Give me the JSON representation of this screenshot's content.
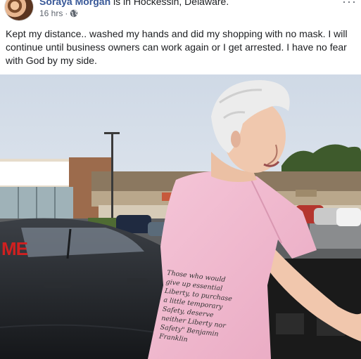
{
  "post": {
    "author": "Soraya Morgan",
    "location_text": "is in Hockessin, Delaware.",
    "timestamp": "16 hrs",
    "privacy_icon": "globe-icon",
    "more_icon": "more-options-icon",
    "text": "Kept my distance.. washed my hands and did my shopping with no mask. I will continue until business owners can work again or I get arrested. I have no fear with God by my side."
  },
  "photo": {
    "store_sign": "ME",
    "shirt_lines": [
      "Those who would",
      "give up essential",
      "Liberty, to purchase",
      "a little temporary",
      "Safety, deserve",
      "neither Liberty nor",
      "Safety\" Benjamin",
      "Franklin"
    ]
  },
  "colors": {
    "author_link": "#385898",
    "meta_gray": "#606770",
    "sky": "#dfe6ee",
    "shirt": "#f1bcd0"
  }
}
